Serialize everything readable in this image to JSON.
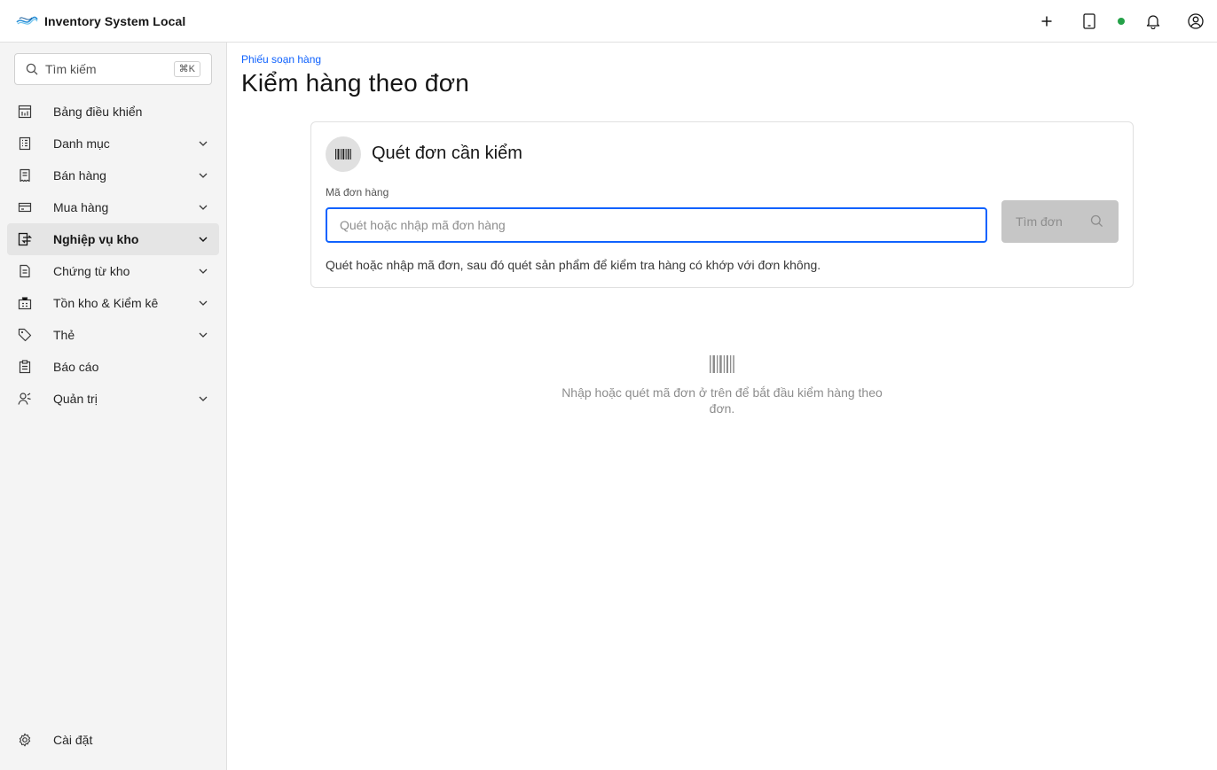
{
  "app": {
    "title": "Inventory System Local"
  },
  "header": {
    "icons": [
      "add-icon",
      "tablet-icon",
      "status-dot",
      "notification-icon",
      "user-avatar-icon"
    ],
    "status_color": "#24a148"
  },
  "sidebar": {
    "search": {
      "label": "Tìm kiếm",
      "shortcut": "⌘K"
    },
    "items": [
      {
        "label": "Bảng điều khiển",
        "icon": "dashboard-icon",
        "expandable": false
      },
      {
        "label": "Danh mục",
        "icon": "catalog-icon",
        "expandable": true
      },
      {
        "label": "Bán hàng",
        "icon": "receipt-icon",
        "expandable": true
      },
      {
        "label": "Mua hàng",
        "icon": "card-icon",
        "expandable": true
      },
      {
        "label": "Nghiệp vụ kho",
        "icon": "warehouse-transfer-icon",
        "expandable": true,
        "active": true
      },
      {
        "label": "Chứng từ kho",
        "icon": "document-icon",
        "expandable": true
      },
      {
        "label": "Tồn kho & Kiểm kê",
        "icon": "inventory-icon",
        "expandable": true
      },
      {
        "label": "Thẻ",
        "icon": "tag-icon",
        "expandable": true
      },
      {
        "label": "Báo cáo",
        "icon": "report-icon",
        "expandable": false
      },
      {
        "label": "Quản trị",
        "icon": "admin-icon",
        "expandable": true
      }
    ],
    "settings_label": "Cài đặt"
  },
  "main": {
    "breadcrumb": "Phiếu soạn hàng",
    "title": "Kiểm hàng theo đơn",
    "card": {
      "title": "Quét đơn cần kiểm",
      "field_label": "Mã đơn hàng",
      "input_value": "",
      "input_placeholder": "Quét hoặc nhập mã đơn hàng",
      "button_label": "Tìm đơn",
      "helper": "Quét hoặc nhập mã đơn, sau đó quét sản phẩm để kiểm tra hàng có khớp với đơn không."
    },
    "empty_state": {
      "text": "Nhập hoặc quét mã đơn ở trên để bắt đầu kiểm hàng theo đơn."
    }
  },
  "colors": {
    "accent": "#0f62fe",
    "sidebar_bg": "#f4f4f4",
    "disabled_button": "#c6c6c6"
  }
}
